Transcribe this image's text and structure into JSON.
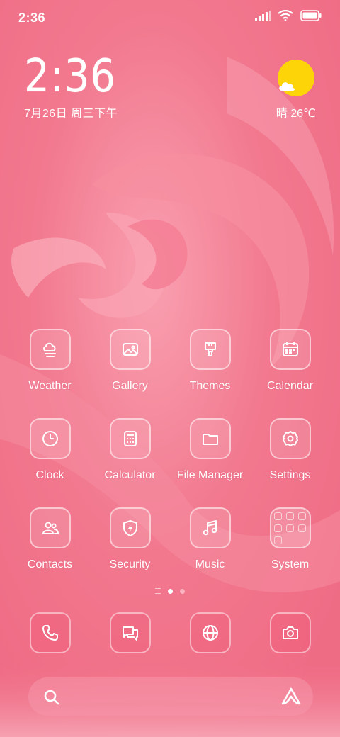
{
  "status_bar": {
    "time": "2:36",
    "icons": [
      "signal-icon",
      "wifi-icon",
      "battery-icon"
    ]
  },
  "clock_widget": {
    "time": "2:36",
    "date": "7月26日 周三下午"
  },
  "weather_widget": {
    "condition_icon": "sun-cloud-icon",
    "text": "晴 26℃"
  },
  "apps": [
    {
      "label": "Weather",
      "icon": "weather-icon"
    },
    {
      "label": "Gallery",
      "icon": "gallery-icon"
    },
    {
      "label": "Themes",
      "icon": "themes-icon"
    },
    {
      "label": "Calendar",
      "icon": "calendar-icon"
    },
    {
      "label": "Clock",
      "icon": "clock-icon"
    },
    {
      "label": "Calculator",
      "icon": "calculator-icon"
    },
    {
      "label": "File Manager",
      "icon": "folder-icon"
    },
    {
      "label": "Settings",
      "icon": "gear-icon"
    },
    {
      "label": "Contacts",
      "icon": "contacts-icon"
    },
    {
      "label": "Security",
      "icon": "shield-icon"
    },
    {
      "label": "Music",
      "icon": "music-icon"
    },
    {
      "label": "System",
      "icon": "folder-system-icon"
    }
  ],
  "page_indicator": {
    "pages": 2,
    "active": 1
  },
  "dock": [
    {
      "icon": "phone-icon"
    },
    {
      "icon": "messages-icon"
    },
    {
      "icon": "browser-icon"
    },
    {
      "icon": "camera-icon"
    }
  ],
  "search_bar": {
    "left_icon": "search-icon",
    "right_icon": "assistant-icon"
  },
  "colors": {
    "background": "#f2758c",
    "sun": "#fcd408",
    "text": "#ffffff"
  }
}
